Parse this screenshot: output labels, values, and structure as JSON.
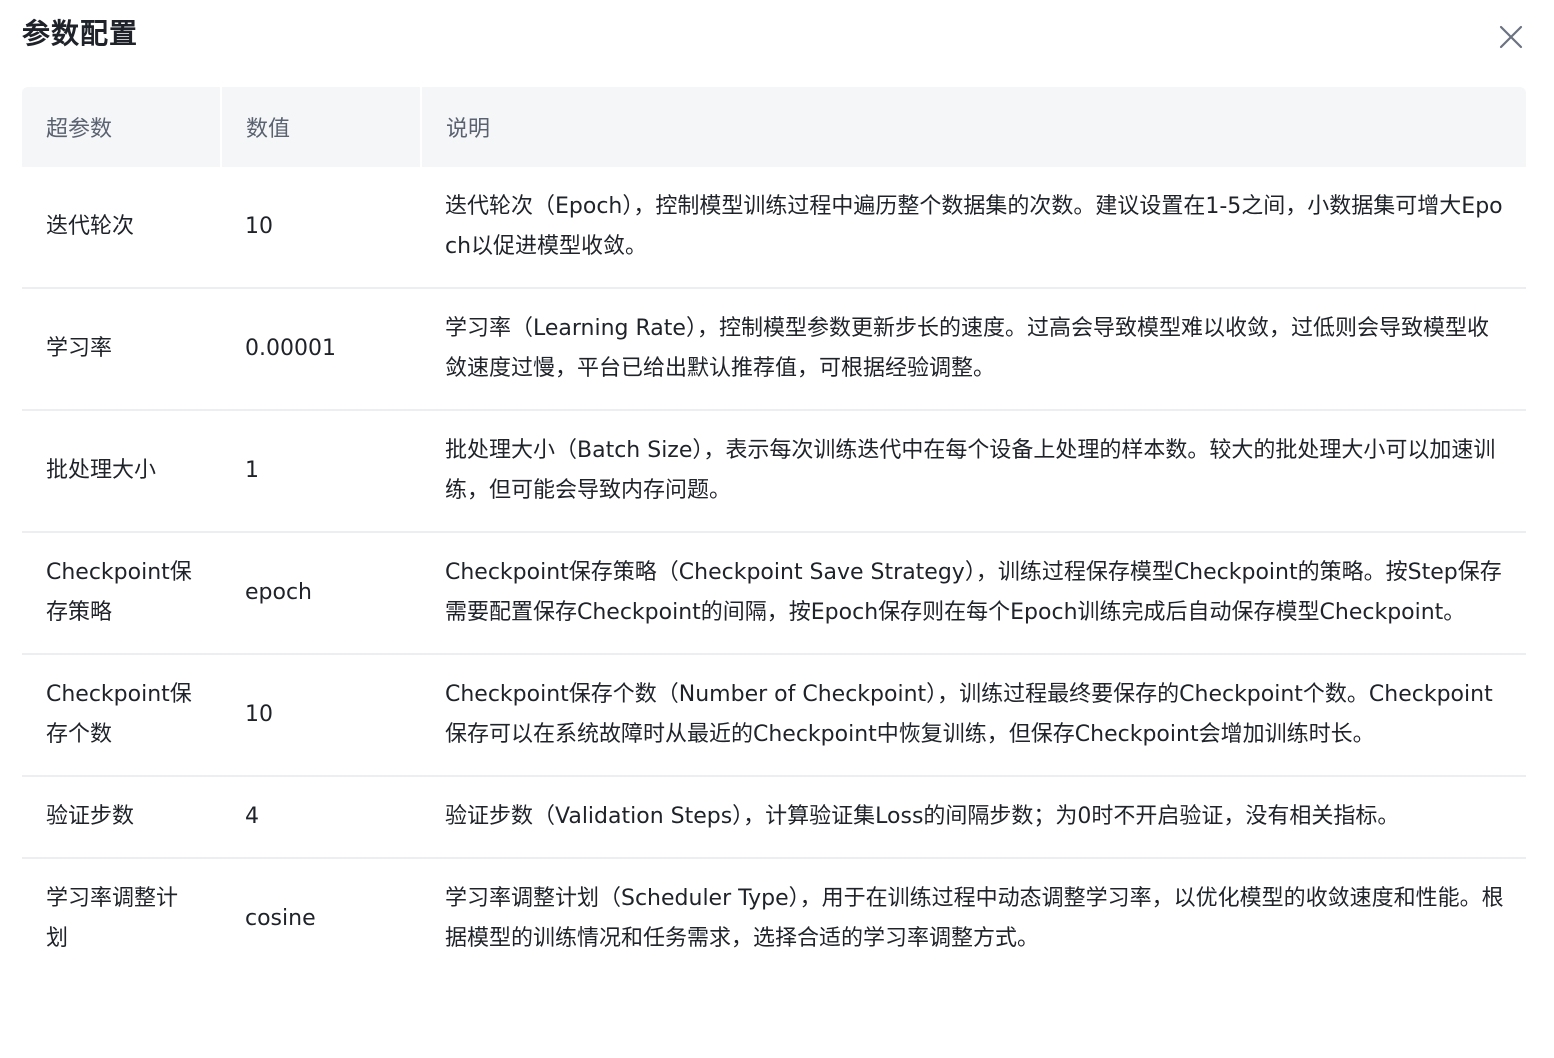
{
  "dialog": {
    "title": "参数配置",
    "close_icon": "close-icon"
  },
  "table": {
    "headers": [
      "超参数",
      "数值",
      "说明"
    ],
    "rows": [
      {
        "name": "迭代轮次",
        "value": "10",
        "desc": "迭代轮次（Epoch），控制模型训练过程中遍历整个数据集的次数。建议设置在1-5之间，小数据集可增大Epoch以促进模型收敛。"
      },
      {
        "name": "学习率",
        "value": "0.00001",
        "desc": "学习率（Learning Rate），控制模型参数更新步长的速度。过高会导致模型难以收敛，过低则会导致模型收敛速度过慢，平台已给出默认推荐值，可根据经验调整。"
      },
      {
        "name": "批处理大小",
        "value": "1",
        "desc": "批处理大小（Batch Size），表示每次训练迭代中在每个设备上处理的样本数。较大的批处理大小可以加速训练，但可能会导致内存问题。"
      },
      {
        "name": "Checkpoint保存策略",
        "value": "epoch",
        "desc": "Checkpoint保存策略（Checkpoint Save Strategy），训练过程保存模型Checkpoint的策略。按Step保存需要配置保存Checkpoint的间隔，按Epoch保存则在每个Epoch训练完成后自动保存模型Checkpoint。"
      },
      {
        "name": "Checkpoint保存个数",
        "value": "10",
        "desc": "Checkpoint保存个数（Number of Checkpoint），训练过程最终要保存的Checkpoint个数。Checkpoint保存可以在系统故障时从最近的Checkpoint中恢复训练，但保存Checkpoint会增加训练时长。"
      },
      {
        "name": "验证步数",
        "value": "4",
        "desc": "验证步数（Validation Steps），计算验证集Loss的间隔步数；为0时不开启验证，没有相关指标。"
      },
      {
        "name": "学习率调整计划",
        "value": "cosine",
        "desc": "学习率调整计划（Scheduler Type），用于在训练过程中动态调整学习率，以优化模型的收敛速度和性能。根据模型的训练情况和任务需求，选择合适的学习率调整方式。"
      }
    ]
  }
}
